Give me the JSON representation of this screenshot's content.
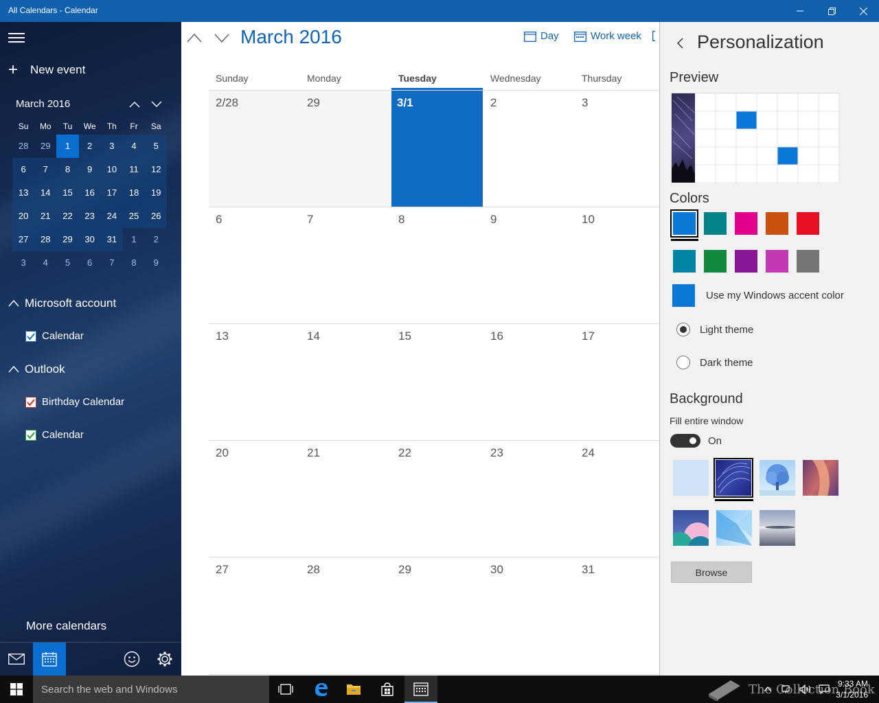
{
  "window": {
    "title": "All Calendars - Calendar",
    "minimize_icon": "minimize-icon",
    "restore_icon": "restore-icon",
    "close_icon": "close-icon"
  },
  "sidebar": {
    "new_event_label": "New event",
    "mini_calendar": {
      "title": "March 2016",
      "weekdays": [
        "Su",
        "Mo",
        "Tu",
        "We",
        "Th",
        "Fr",
        "Sa"
      ],
      "weeks": [
        [
          {
            "d": "28",
            "cur": false
          },
          {
            "d": "29",
            "cur": false
          },
          {
            "d": "1",
            "cur": true,
            "today": true
          },
          {
            "d": "2",
            "cur": true
          },
          {
            "d": "3",
            "cur": true
          },
          {
            "d": "4",
            "cur": true
          },
          {
            "d": "5",
            "cur": true
          }
        ],
        [
          {
            "d": "6",
            "cur": true
          },
          {
            "d": "7",
            "cur": true
          },
          {
            "d": "8",
            "cur": true
          },
          {
            "d": "9",
            "cur": true
          },
          {
            "d": "10",
            "cur": true
          },
          {
            "d": "11",
            "cur": true
          },
          {
            "d": "12",
            "cur": true
          }
        ],
        [
          {
            "d": "13",
            "cur": true
          },
          {
            "d": "14",
            "cur": true
          },
          {
            "d": "15",
            "cur": true
          },
          {
            "d": "16",
            "cur": true
          },
          {
            "d": "17",
            "cur": true
          },
          {
            "d": "18",
            "cur": true
          },
          {
            "d": "19",
            "cur": true
          }
        ],
        [
          {
            "d": "20",
            "cur": true
          },
          {
            "d": "21",
            "cur": true
          },
          {
            "d": "22",
            "cur": true
          },
          {
            "d": "23",
            "cur": true
          },
          {
            "d": "24",
            "cur": true
          },
          {
            "d": "25",
            "cur": true
          },
          {
            "d": "26",
            "cur": true
          }
        ],
        [
          {
            "d": "27",
            "cur": true
          },
          {
            "d": "28",
            "cur": true
          },
          {
            "d": "29",
            "cur": true
          },
          {
            "d": "30",
            "cur": true
          },
          {
            "d": "31",
            "cur": true
          },
          {
            "d": "1",
            "cur": false
          },
          {
            "d": "2",
            "cur": false
          }
        ],
        [
          {
            "d": "3",
            "cur": false
          },
          {
            "d": "4",
            "cur": false
          },
          {
            "d": "5",
            "cur": false
          },
          {
            "d": "6",
            "cur": false
          },
          {
            "d": "7",
            "cur": false
          },
          {
            "d": "8",
            "cur": false
          },
          {
            "d": "9",
            "cur": false
          }
        ]
      ]
    },
    "accounts": [
      {
        "name": "Microsoft account",
        "calendars": [
          {
            "label": "Calendar",
            "checked": true,
            "color": "#1a73c9"
          }
        ]
      },
      {
        "name": "Outlook",
        "calendars": [
          {
            "label": "Birthday Calendar",
            "checked": true,
            "color": "#c8321e"
          },
          {
            "label": "Calendar",
            "checked": true,
            "color": "#2c9b3c"
          }
        ]
      }
    ],
    "more_calendars_label": "More calendars",
    "bottom_icons": [
      "mail-icon",
      "calendar-icon",
      "smiley-icon",
      "gear-icon"
    ]
  },
  "main": {
    "month_title": "March 2016",
    "views": {
      "day_label": "Day",
      "work_week_label": "Work week"
    },
    "day_headers": [
      "Sunday",
      "Monday",
      "Tuesday",
      "Wednesday",
      "Thursday"
    ],
    "today_column": 2,
    "weeks": [
      [
        "2/28",
        "29",
        "3/1",
        "2",
        "3"
      ],
      [
        "6",
        "7",
        "8",
        "9",
        "10"
      ],
      [
        "13",
        "14",
        "15",
        "16",
        "17"
      ],
      [
        "20",
        "21",
        "22",
        "23",
        "24"
      ],
      [
        "27",
        "28",
        "29",
        "30",
        "31"
      ]
    ],
    "today_color": "#0f6cc2"
  },
  "panel": {
    "title": "Personalization",
    "preview_title": "Preview",
    "colors_title": "Colors",
    "colors_row1": [
      "#0a78d7",
      "#038387",
      "#e3008c",
      "#ca5010",
      "#e81123"
    ],
    "colors_row2": [
      "#0084a5",
      "#10893e",
      "#881798",
      "#c239b3",
      "#767676"
    ],
    "selected_color": "#0a78d7",
    "accent_label": "Use my Windows accent color",
    "light_theme_label": "Light theme",
    "dark_theme_label": "Dark theme",
    "theme_selected": "light",
    "background_title": "Background",
    "fill_window_label": "Fill entire window",
    "toggle_label": "On",
    "toggle_on": true,
    "browse_label": "Browse"
  },
  "taskbar": {
    "search_placeholder": "Search the web and Windows",
    "time": "9:33 AM",
    "date": "3/1/2016",
    "watermark": "The Collection Book"
  }
}
